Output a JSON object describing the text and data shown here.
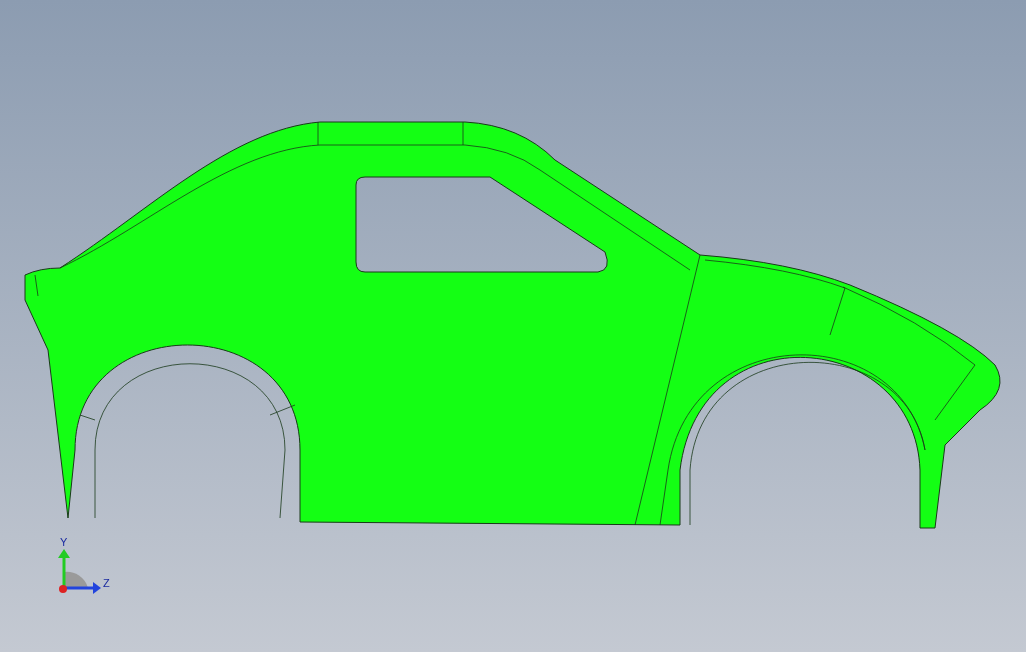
{
  "viewport": {
    "triad": {
      "vertical_axis_label": "Y",
      "horizontal_axis_label": "Z"
    }
  }
}
